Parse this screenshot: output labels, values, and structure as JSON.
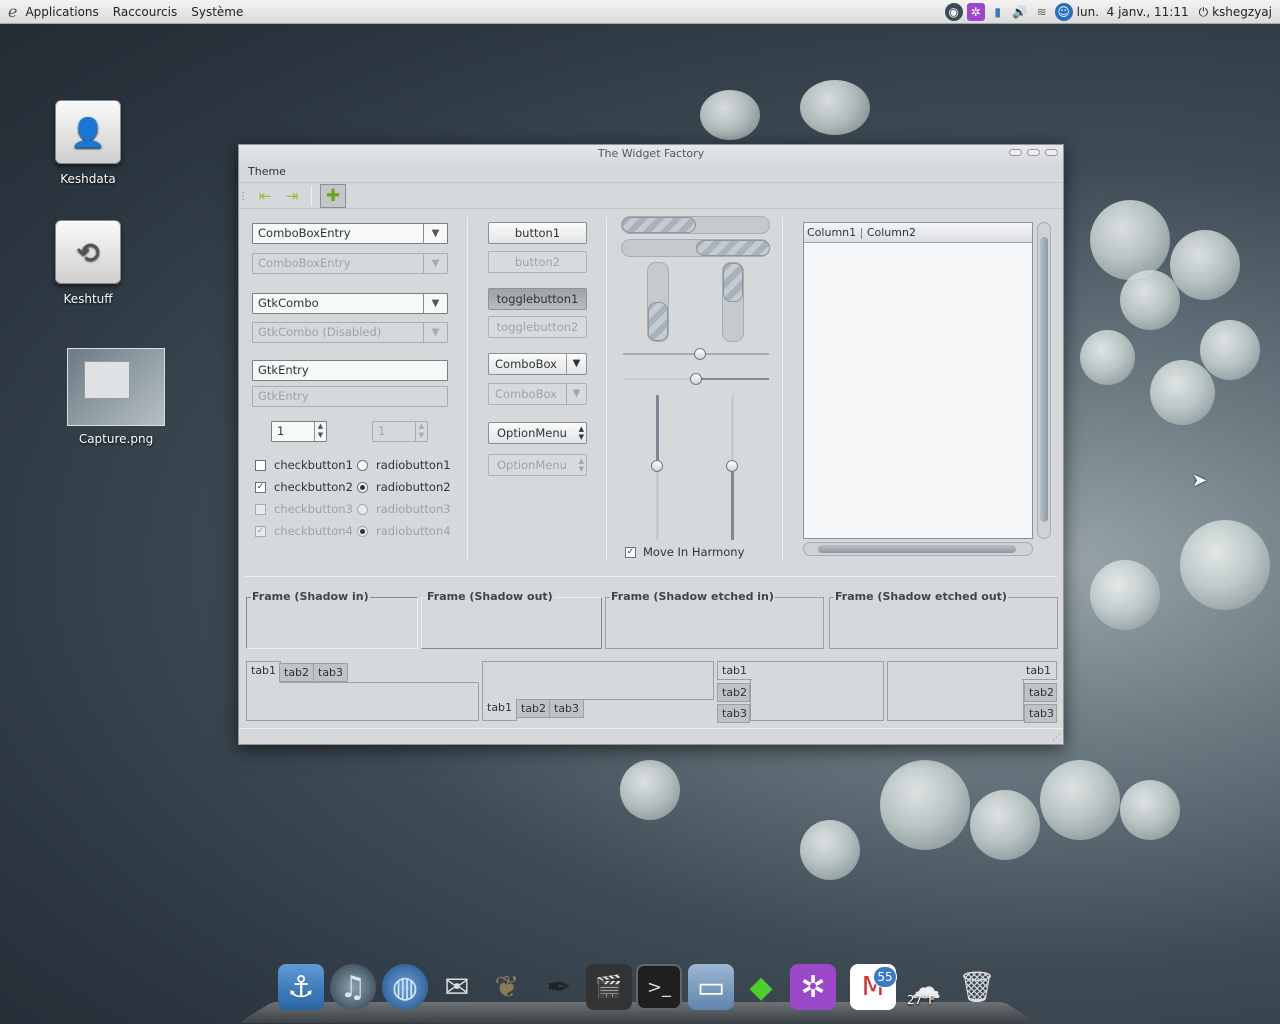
{
  "panel": {
    "menus": [
      "Applications",
      "Raccourcis",
      "Système"
    ],
    "clock": "lun.  4 janv., 11:11",
    "user": "kshegzyaj"
  },
  "desktop": {
    "icons": [
      {
        "label": "Keshdata",
        "icon": "person-drive-icon"
      },
      {
        "label": "Keshtuff",
        "icon": "backup-drive-icon"
      },
      {
        "label": "Capture.png",
        "icon": "image-thumbnail-icon"
      }
    ]
  },
  "window": {
    "title": "The Widget Factory",
    "menu": "Theme",
    "col1": {
      "combo_entry": "ComboBoxEntry",
      "combo_entry_disabled": "ComboBoxEntry",
      "gtkcombo": "GtkCombo",
      "gtkcombo_disabled": "GtkCombo (Disabled)",
      "entry": "GtkEntry",
      "entry_disabled": "GtkEntry",
      "spin": "1",
      "spin_disabled": "1",
      "checks": [
        {
          "label": "checkbutton1",
          "checked": false
        },
        {
          "label": "checkbutton2",
          "checked": true
        },
        {
          "label": "checkbutton3",
          "checked": false
        },
        {
          "label": "checkbutton4",
          "checked": true
        }
      ],
      "radios": [
        {
          "label": "radiobutton1",
          "selected": false
        },
        {
          "label": "radiobutton2",
          "selected": true
        },
        {
          "label": "radiobutton3",
          "selected": false
        },
        {
          "label": "radiobutton4",
          "selected": true
        }
      ]
    },
    "col2": {
      "button1": "button1",
      "button2": "button2",
      "toggle1": "togglebutton1",
      "toggle2": "togglebutton2",
      "combobox": "ComboBox",
      "combobox_disabled": "ComboBox",
      "optionmenu": "OptionMenu",
      "optionmenu_disabled": "OptionMenu"
    },
    "col3": {
      "progress_h1": 0.5,
      "progress_h2": 0.5,
      "move_in_harmony": "Move In Harmony"
    },
    "tree": {
      "columns": [
        "Column1",
        "Column2"
      ]
    },
    "frames": [
      "Frame (Shadow in)",
      "Frame (Shadow out)",
      "Frame (Shadow etched in)",
      "Frame (Shadow etched out)"
    ],
    "tabs": [
      "tab1",
      "tab2",
      "tab3"
    ]
  },
  "weather": "27°F",
  "mail_count": "55"
}
